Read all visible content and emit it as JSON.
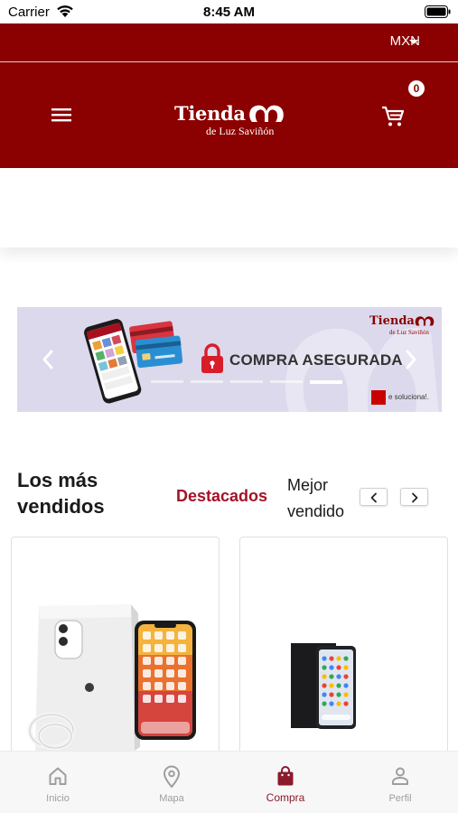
{
  "status_bar": {
    "carrier": "Carrier",
    "time": "8:45 AM"
  },
  "header": {
    "currency": "MXN",
    "logo_main": "Tienda",
    "logo_sub": "de Luz Saviñón",
    "cart_count": "0"
  },
  "banner": {
    "headline": "COMPRA ASEGURADA",
    "logo_main": "Tienda",
    "logo_sub": "de Luz Saviñón",
    "tag": "e soluciona!.",
    "slide_count": 5,
    "active_slide": 4
  },
  "section": {
    "title": "Los más vendidos",
    "tabs": [
      {
        "label": "Destacados",
        "active": true
      },
      {
        "label": "Mejor vendido",
        "active": false
      }
    ]
  },
  "products": [
    {
      "image": "iphone-11-box-product-image"
    },
    {
      "image": "android-phone-box-product-image"
    }
  ],
  "bottom_nav": {
    "items": [
      {
        "label": "Inicio",
        "icon": "home-icon"
      },
      {
        "label": "Mapa",
        "icon": "map-pin-icon"
      },
      {
        "label": "Compra",
        "icon": "shopping-bag-icon",
        "active": true
      },
      {
        "label": "Perfil",
        "icon": "person-icon"
      }
    ]
  },
  "colors": {
    "brand": "#8b0000",
    "accent_text": "#a31328",
    "banner_bg": "#dcd9ec"
  }
}
